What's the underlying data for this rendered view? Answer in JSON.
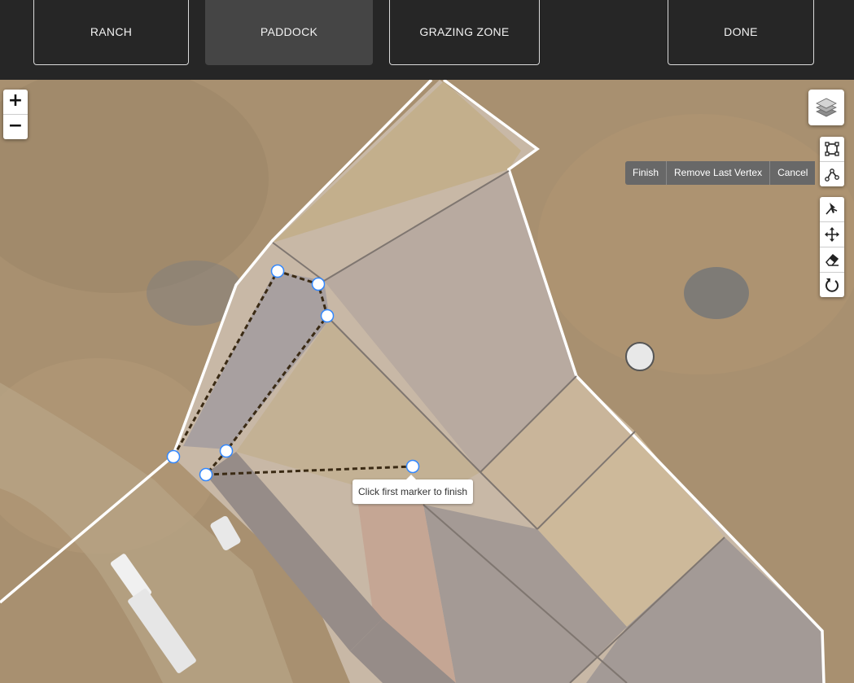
{
  "nav": {
    "ranch": "RANCH",
    "paddock": "PADDOCK",
    "grazing_zone": "GRAZING ZONE",
    "done": "DONE"
  },
  "map": {
    "zoom_in": "+",
    "zoom_out": "−",
    "layers_icon": "layers-icon",
    "draw_tools": [
      "rectangle-draw-icon",
      "polygon-draw-icon"
    ],
    "edit_tools": [
      "cut-icon",
      "move-icon",
      "eraser-icon",
      "rotate-icon"
    ],
    "actions": {
      "finish": "Finish",
      "remove_last_vertex": "Remove Last Vertex",
      "cancel": "Cancel"
    },
    "tooltip": "Click first marker to finish"
  },
  "colors": {
    "nav_bg": "#262626",
    "nav_active": "#454545",
    "vertex_stroke": "#3388ff",
    "draw_line": "#3a2a14"
  }
}
